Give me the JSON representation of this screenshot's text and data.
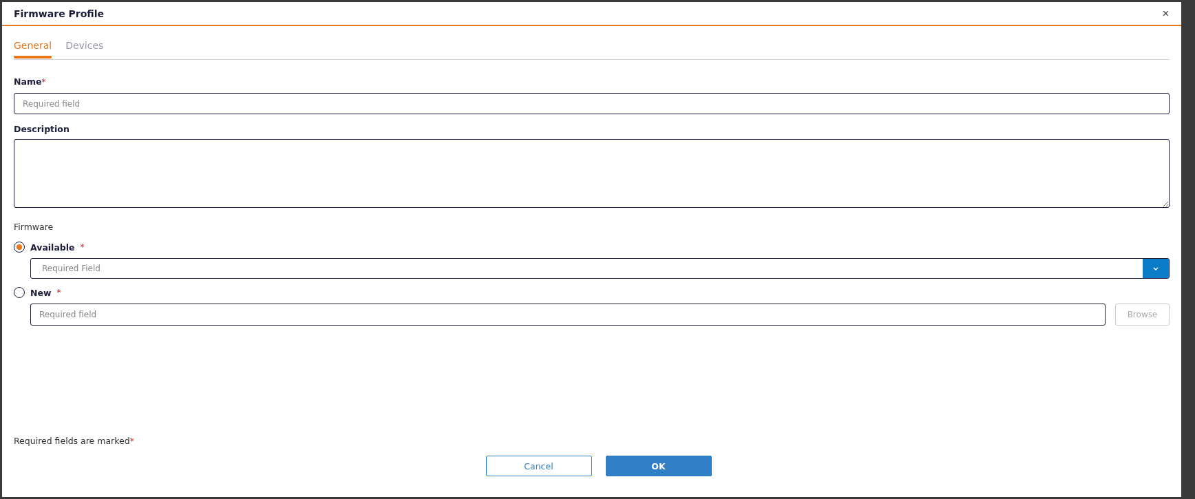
{
  "dialog": {
    "title": "Firmware Profile",
    "close": "×"
  },
  "tabs": [
    {
      "label": "General",
      "selected": true
    },
    {
      "label": "Devices",
      "selected": false
    }
  ],
  "name_field": {
    "label": "Name",
    "mark": "*",
    "placeholder": "Required field"
  },
  "description_field": {
    "label": "Description"
  },
  "firmware": {
    "label": "Firmware",
    "options": [
      {
        "kind": "dropdown",
        "label": "Available",
        "mark": "*",
        "selected": true,
        "placeholder": "Required Field"
      },
      {
        "kind": "file",
        "label": "New",
        "mark": "*",
        "selected": false,
        "placeholder": "Required field",
        "button": "Browse"
      }
    ]
  },
  "footer_note": {
    "text": "Required fields are marked",
    "mark": "*"
  },
  "buttons": [
    {
      "label": "Cancel",
      "kind": "secondary"
    },
    {
      "label": "OK",
      "kind": "primary"
    }
  ]
}
